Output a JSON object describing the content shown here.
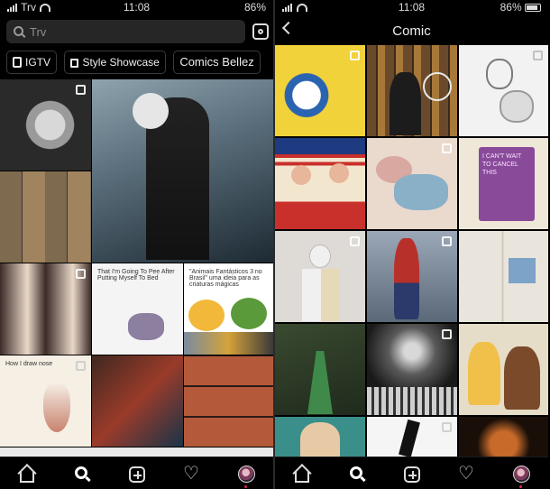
{
  "left_screen": {
    "status": {
      "carrier": "Trv",
      "time": "11:08",
      "battery": "86%"
    },
    "search": {
      "placeholder": "Trv"
    },
    "chips": [
      {
        "label": "IGTV"
      },
      {
        "label": "Style Showcase"
      },
      {
        "label": "Comics"
      },
      {
        "label": "Bellez"
      }
    ],
    "tiles": [
      {
        "name": "tile-portrait-bw",
        "colors": [
          "#bdbdbd",
          "#2a2a2a"
        ]
      },
      {
        "name": "tile-video-winter-embrace",
        "colors": [
          "#5b6f7c",
          "#1d2a33"
        ]
      },
      {
        "name": "tile-group-selfies",
        "colors": [
          "#7d6a4f",
          "#3b3530"
        ]
      },
      {
        "name": "tile-girl-peace-sign",
        "colors": [
          "#e9d8c8",
          "#3c2b28"
        ]
      },
      {
        "name": "tile-tom-meme",
        "colors": [
          "#f4f4f4",
          "#8c7fa0"
        ],
        "text": "That I'm Going To Pee After Putting Myself To Bed"
      },
      {
        "name": "tile-parrot-meme",
        "colors": [
          "#ffffff",
          "#5a9a3a"
        ],
        "text": "\"Animais Fantásticos 3 no Brasil\" uma ideia para as criaturas mágicas"
      },
      {
        "name": "tile-nose-drawing",
        "colors": [
          "#f5efe4",
          "#c9826f"
        ],
        "text": "How I draw nose"
      },
      {
        "name": "tile-red-masks",
        "colors": [
          "#402820",
          "#9a3b2a"
        ]
      },
      {
        "name": "tile-redhead-collage",
        "colors": [
          "#b45a3a",
          "#2b1a1a"
        ]
      },
      {
        "name": "tile-dark-blue",
        "colors": [
          "#1a3347",
          "#304c5a"
        ]
      }
    ],
    "nav": [
      "home-icon",
      "search-icon",
      "add-icon",
      "heart-icon",
      "profile-avatar"
    ]
  },
  "right_screen": {
    "status": {
      "time": "11:08",
      "battery": "86%"
    },
    "title": "Comic",
    "tiles": [
      {
        "name": "tile-donald-duck",
        "colors": [
          "#f1d23a",
          "#2a63b0"
        ]
      },
      {
        "name": "tile-bookshelf-reader",
        "colors": [
          "#6b4a2c",
          "#1c1c1c"
        ]
      },
      {
        "name": "tile-sketch-father-baby",
        "colors": [
          "#f2f2f2",
          "#9a9a9a"
        ]
      },
      {
        "name": "tile-retro-girls-table",
        "colors": [
          "#c9302c",
          "#f3e6cf"
        ]
      },
      {
        "name": "tile-sleeping-illustration",
        "colors": [
          "#ead9cd",
          "#8ab0c8"
        ]
      },
      {
        "name": "tile-purple-book",
        "colors": [
          "#8a4a9a",
          "#efe7d8"
        ],
        "text": "I CAN'T WAIT TO CANCEL THIS"
      },
      {
        "name": "tile-skeleton-boy",
        "colors": [
          "#dedad6",
          "#3a3a3a"
        ]
      },
      {
        "name": "tile-spiderman-cosplay",
        "colors": [
          "#b8302a",
          "#2b3a6a"
        ]
      },
      {
        "name": "tile-open-book",
        "colors": [
          "#e9e4dc",
          "#7da3c8"
        ]
      },
      {
        "name": "tile-forest-green-dress",
        "colors": [
          "#3f6b3a",
          "#1f2a1c"
        ]
      },
      {
        "name": "tile-joker-stairs",
        "colors": [
          "#d8d8d8",
          "#1a1a1a"
        ]
      },
      {
        "name": "tile-comic-couple",
        "colors": [
          "#f1c04a",
          "#4a6aa0"
        ]
      },
      {
        "name": "tile-cartoon-boy",
        "colors": [
          "#e8c9a6",
          "#3b8f8a"
        ]
      },
      {
        "name": "tile-black-white-pose",
        "colors": [
          "#f5f5f5",
          "#111111"
        ]
      },
      {
        "name": "tile-orange-sculpture",
        "colors": [
          "#c76a2a",
          "#1a0f08"
        ]
      }
    ],
    "nav": [
      "home-icon",
      "search-icon",
      "add-icon",
      "heart-icon",
      "profile-avatar"
    ]
  }
}
